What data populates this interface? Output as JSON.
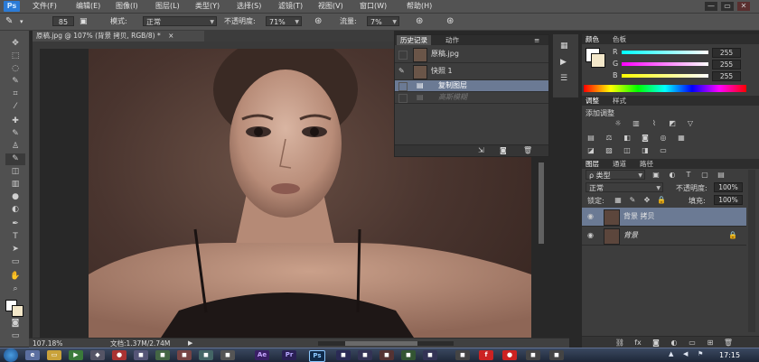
{
  "app": {
    "logo": "Ps",
    "menus": [
      "文件(F)",
      "编辑(E)",
      "图像(I)",
      "图层(L)",
      "类型(Y)",
      "选择(S)",
      "滤镜(T)",
      "视图(V)",
      "窗口(W)",
      "帮助(H)"
    ],
    "window_buttons": [
      "—",
      "▭",
      "✕"
    ]
  },
  "options": {
    "brush_size": "85",
    "mode_label": "模式:",
    "mode_value": "正常",
    "opacity_label": "不透明度:",
    "opacity_value": "71%",
    "flow_label": "流量:",
    "flow_value": "7%"
  },
  "document": {
    "tab_title": "原稿.jpg @ 107% (背景 拷贝, RGB/8) *",
    "tab_close": "×",
    "zoom": "107.18%",
    "doc_info": "文档:1.37M/2.74M"
  },
  "history": {
    "tabs": [
      "历史记录",
      "动作"
    ],
    "items": [
      {
        "label": "原稿.jpg"
      },
      {
        "label": "快照 1"
      },
      {
        "label": "复制图层"
      },
      {
        "label": "高斯模糊"
      }
    ]
  },
  "color": {
    "tabs": [
      "颜色",
      "色板"
    ],
    "channels": [
      {
        "name": "R",
        "value": "255"
      },
      {
        "name": "G",
        "value": "255"
      },
      {
        "name": "B",
        "value": "255"
      }
    ]
  },
  "adjustments": {
    "tabs": [
      "调整",
      "样式"
    ],
    "add_label": "添加调整"
  },
  "layers": {
    "tabs": [
      "图层",
      "通道",
      "路径"
    ],
    "filter_label": "ρ 类型",
    "blend_mode": "正常",
    "opacity_label": "不透明度:",
    "opacity_value": "100%",
    "lock_label": "锁定:",
    "fill_label": "填充:",
    "fill_value": "100%",
    "items": [
      {
        "name": "背景 拷贝"
      },
      {
        "name": "背景"
      }
    ]
  },
  "taskbar": {
    "apps": [
      "Ae",
      "Pr",
      "Ps"
    ],
    "clock": "17:15"
  }
}
